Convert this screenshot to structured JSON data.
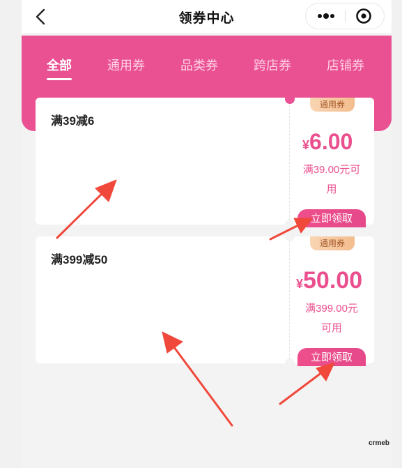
{
  "nav": {
    "title": "领券中心",
    "back_icon": "chevron-left-icon",
    "more_icon": "more-dots-icon",
    "close_icon": "target-circle-icon"
  },
  "tabs": [
    {
      "label": "全部",
      "active": true
    },
    {
      "label": "通用券",
      "active": false
    },
    {
      "label": "品类券",
      "active": false
    },
    {
      "label": "跨店券",
      "active": false
    },
    {
      "label": "店铺券",
      "active": false
    }
  ],
  "coupons": [
    {
      "title": "满39减6",
      "badge": "通用券",
      "currency": "¥",
      "amount": "6.00",
      "condition_line1": "满39.00元可",
      "condition_line2": "用",
      "button": "立即领取"
    },
    {
      "title": "满399减50",
      "badge": "通用券",
      "currency": "¥",
      "amount": "50.00",
      "condition_line1": "满399.00元",
      "condition_line2": "可用",
      "button": "立即领取"
    }
  ],
  "watermark": "crmeb",
  "colors": {
    "primary": "#ea5193",
    "accent_text": "#ea4f8e",
    "badge_bg": "#f6c9a0",
    "badge_text": "#a4582a",
    "annotation_arrow": "#f0483b"
  }
}
